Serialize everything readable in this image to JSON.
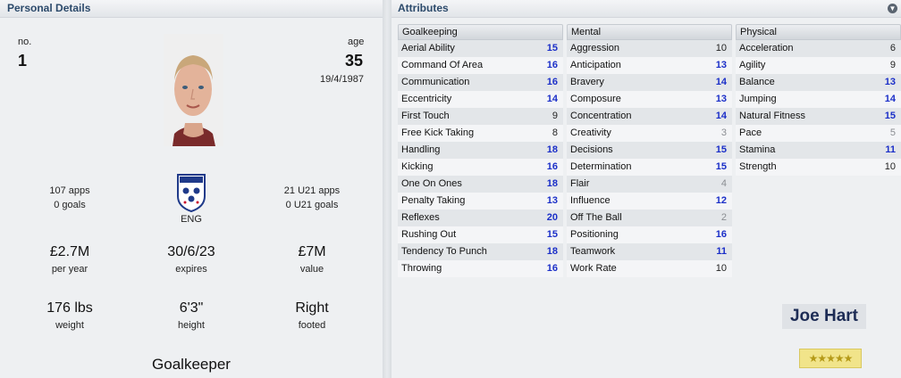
{
  "personal": {
    "header": "Personal Details",
    "number_label": "no.",
    "number": "1",
    "age_label": "age",
    "age": "35",
    "dob": "19/4/1987",
    "apps": "107 apps",
    "goals": "0 goals",
    "nation": "ENG",
    "u21_apps": "21 U21 apps",
    "u21_goals": "0 U21 goals",
    "wage": "£2.7M",
    "wage_label": "per year",
    "expires": "30/6/23",
    "expires_label": "expires",
    "value": "£7M",
    "value_label": "value",
    "weight": "176 lbs",
    "weight_label": "weight",
    "height": "6'3\"",
    "height_label": "height",
    "foot": "Right",
    "foot_label": "footed",
    "position": "Goalkeeper"
  },
  "attributes": {
    "header": "Attributes",
    "goalkeeping": {
      "title": "Goalkeeping",
      "rows": [
        {
          "name": "Aerial Ability",
          "value": "15",
          "tone": "blue"
        },
        {
          "name": "Command Of Area",
          "value": "16",
          "tone": "blue"
        },
        {
          "name": "Communication",
          "value": "16",
          "tone": "blue"
        },
        {
          "name": "Eccentricity",
          "value": "14",
          "tone": "blue"
        },
        {
          "name": "First Touch",
          "value": "9",
          "tone": "dark"
        },
        {
          "name": "Free Kick Taking",
          "value": "8",
          "tone": "dark"
        },
        {
          "name": "Handling",
          "value": "18",
          "tone": "blue"
        },
        {
          "name": "Kicking",
          "value": "16",
          "tone": "blue"
        },
        {
          "name": "One On Ones",
          "value": "18",
          "tone": "blue"
        },
        {
          "name": "Penalty Taking",
          "value": "13",
          "tone": "blue"
        },
        {
          "name": "Reflexes",
          "value": "20",
          "tone": "blue"
        },
        {
          "name": "Rushing Out",
          "value": "15",
          "tone": "blue"
        },
        {
          "name": "Tendency To Punch",
          "value": "18",
          "tone": "blue"
        },
        {
          "name": "Throwing",
          "value": "16",
          "tone": "blue"
        }
      ]
    },
    "mental": {
      "title": "Mental",
      "rows": [
        {
          "name": "Aggression",
          "value": "10",
          "tone": "dark"
        },
        {
          "name": "Anticipation",
          "value": "13",
          "tone": "blue"
        },
        {
          "name": "Bravery",
          "value": "14",
          "tone": "blue"
        },
        {
          "name": "Composure",
          "value": "13",
          "tone": "blue"
        },
        {
          "name": "Concentration",
          "value": "14",
          "tone": "blue"
        },
        {
          "name": "Creativity",
          "value": "3",
          "tone": "grey"
        },
        {
          "name": "Decisions",
          "value": "15",
          "tone": "blue"
        },
        {
          "name": "Determination",
          "value": "15",
          "tone": "blue"
        },
        {
          "name": "Flair",
          "value": "4",
          "tone": "grey"
        },
        {
          "name": "Influence",
          "value": "12",
          "tone": "blue"
        },
        {
          "name": "Off The Ball",
          "value": "2",
          "tone": "grey"
        },
        {
          "name": "Positioning",
          "value": "16",
          "tone": "blue"
        },
        {
          "name": "Teamwork",
          "value": "11",
          "tone": "blue"
        },
        {
          "name": "Work Rate",
          "value": "10",
          "tone": "dark"
        }
      ]
    },
    "physical": {
      "title": "Physical",
      "rows": [
        {
          "name": "Acceleration",
          "value": "6",
          "tone": "dark"
        },
        {
          "name": "Agility",
          "value": "9",
          "tone": "dark"
        },
        {
          "name": "Balance",
          "value": "13",
          "tone": "blue"
        },
        {
          "name": "Jumping",
          "value": "14",
          "tone": "blue"
        },
        {
          "name": "Natural Fitness",
          "value": "15",
          "tone": "blue"
        },
        {
          "name": "Pace",
          "value": "5",
          "tone": "grey"
        },
        {
          "name": "Stamina",
          "value": "11",
          "tone": "blue"
        },
        {
          "name": "Strength",
          "value": "10",
          "tone": "dark"
        }
      ]
    }
  },
  "player_name": "Joe Hart",
  "rating": {
    "stars": 5,
    "glyphs": "★★★★★"
  },
  "colors": {
    "high": "#1b2fc8",
    "mid": "#222222",
    "low": "#8a8d92",
    "header_text": "#2c4a6b"
  }
}
